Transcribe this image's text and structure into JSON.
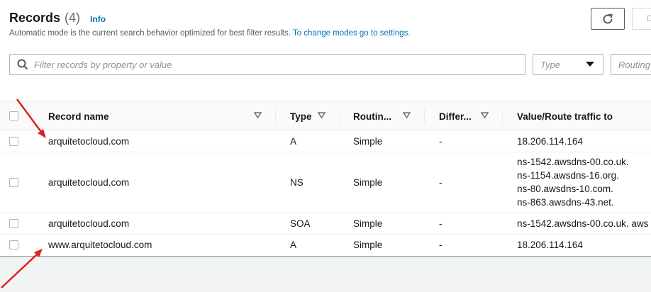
{
  "header": {
    "title": "Records",
    "count": "(4)",
    "info_link": "Info",
    "description": "Automatic mode is the current search behavior optimized for best filter results.",
    "description_link": "To change modes go to settings.",
    "delete_label": "D"
  },
  "filters": {
    "search_placeholder": "Filter records by property or value",
    "type_placeholder": "Type",
    "routing_placeholder": "Routing"
  },
  "table": {
    "columns": [
      "Record name",
      "Type",
      "Routin...",
      "Differ...",
      "Value/Route traffic to"
    ],
    "rows": [
      {
        "name": "arquitetocloud.com",
        "type": "A",
        "routing": "Simple",
        "differ": "-",
        "values": [
          "18.206.114.164"
        ]
      },
      {
        "name": "arquitetocloud.com",
        "type": "NS",
        "routing": "Simple",
        "differ": "-",
        "values": [
          "ns-1542.awsdns-00.co.uk.",
          "ns-1154.awsdns-16.org.",
          "ns-80.awsdns-10.com.",
          "ns-863.awsdns-43.net."
        ]
      },
      {
        "name": "arquitetocloud.com",
        "type": "SOA",
        "routing": "Simple",
        "differ": "-",
        "values": [
          "ns-1542.awsdns-00.co.uk. aws"
        ]
      },
      {
        "name": "www.arquitetocloud.com",
        "type": "A",
        "routing": "Simple",
        "differ": "-",
        "values": [
          "18.206.114.164"
        ]
      }
    ]
  },
  "icons": {
    "refresh": "refresh-icon",
    "search": "search-icon",
    "dropdown": "caret-down-icon",
    "sort": "sort-triangle-icon",
    "annotation": "red-arrow"
  },
  "colors": {
    "link": "#0073bb",
    "annotation_arrow": "#e02020",
    "text": "#16191f",
    "muted": "#545b64"
  }
}
